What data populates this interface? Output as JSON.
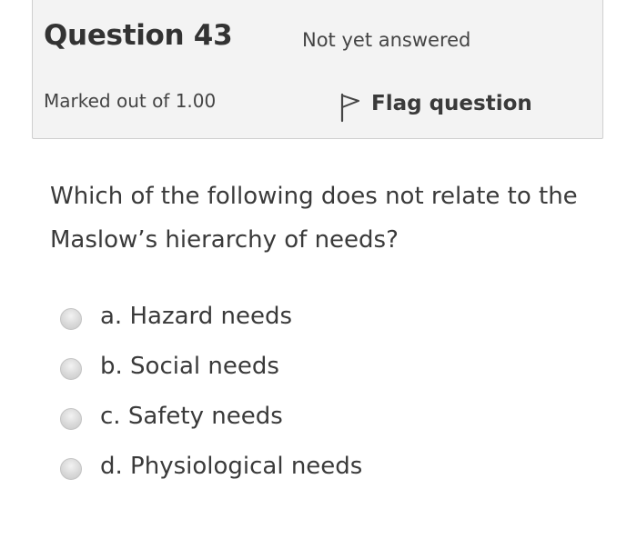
{
  "question": {
    "number_label": "Question 43",
    "state": "Not yet answered",
    "grade": "Marked out of 1.00",
    "flag_label": "Flag question",
    "flag_icon": "flag-icon",
    "text": "Which of the following does not relate to the Maslow’s hierarchy of needs?"
  },
  "answers": [
    {
      "label": "a. Hazard needs",
      "selected": false
    },
    {
      "label": "b. Social needs",
      "selected": false
    },
    {
      "label": "c. Safety needs",
      "selected": false
    },
    {
      "label": "d. Physiological needs",
      "selected": false
    }
  ],
  "colors": {
    "info_background": "#f3f3f3",
    "info_border": "#cfcfcf",
    "text": "#333333"
  }
}
